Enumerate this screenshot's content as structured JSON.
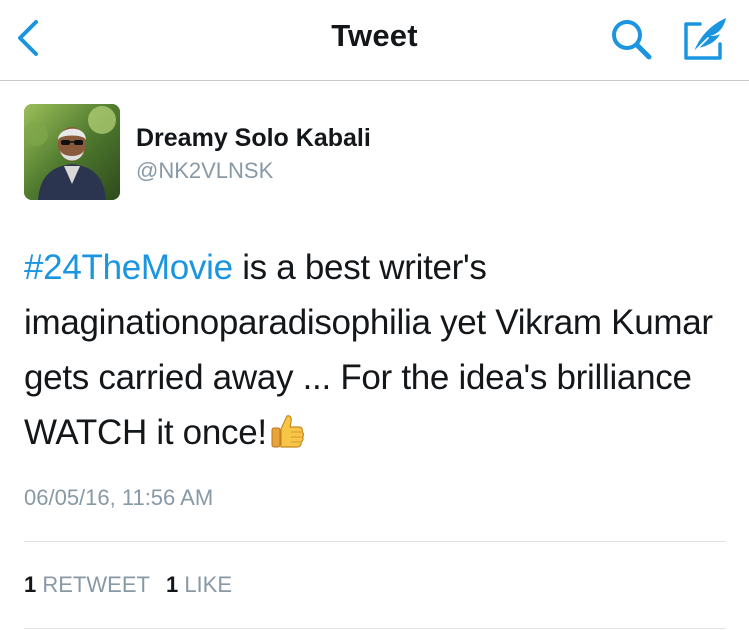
{
  "colors": {
    "accent": "#1b95e0",
    "text_primary": "#14171a",
    "text_secondary": "#8899a6"
  },
  "navbar": {
    "title": "Tweet",
    "back_icon": "chevron-left-icon",
    "search_icon": "search-icon",
    "compose_icon": "compose-tweet-icon"
  },
  "author": {
    "display_name": "Dreamy Solo Kabali",
    "handle": "@NK2VLNSK"
  },
  "tweet": {
    "hashtag": "#24TheMovie",
    "text": " is a best writer's imaginationoparadisophilia yet Vikram Kumar gets carried away ... For the idea's brilliance WATCH it once!",
    "emoji": "thumbs-up-icon",
    "timestamp": "06/05/16, 11:56 AM"
  },
  "stats": {
    "retweet_count": "1",
    "retweet_label": "RETWEET",
    "like_count": "1",
    "like_label": "LIKE"
  }
}
